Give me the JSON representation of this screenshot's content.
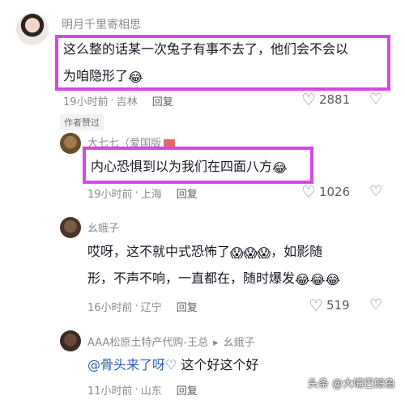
{
  "comments": [
    {
      "author": "明月千里寄相思",
      "line1": "这么整的话某一次兔子有事不去了，他们会不会以",
      "line2": "为咱隐形了",
      "emoji": "😂",
      "time": "19小时前",
      "location": "吉林",
      "reply_label": "回复",
      "likes": "2881",
      "badge": "作者赞过"
    },
    {
      "author": "大七七（爱国版",
      "text": "内心恐惧到以为我们在四面八方",
      "emoji": "😂",
      "time": "19小时前",
      "location": "上海",
      "reply_label": "回复",
      "likes": "1026"
    },
    {
      "author": "幺蛾子",
      "line1": "哎呀，这不就中式恐怖了",
      "emoji1": "😱😱😱",
      "line1b": "，如影随",
      "line2": "形，不声不响，一直都在，随时爆发",
      "emoji2": "😂😂😂",
      "time": "16小时前",
      "location": "辽宁",
      "reply_label": "回复",
      "likes": "519"
    },
    {
      "author": "AAA松原土特产代购-王总",
      "reply_to": "幺蛾子",
      "mention": "@骨头来了呀♡",
      "text": " 这个好这个好",
      "time": "11小时前",
      "location": "山东",
      "reply_label": "回复"
    }
  ],
  "watermark": "头条 @大嘴巴鲸鱼",
  "icons": {
    "like": "heart-outline-icon",
    "dislike": "broken-heart-icon"
  },
  "colors": {
    "highlight": "#d646e8",
    "mention": "#2a5ea8"
  }
}
